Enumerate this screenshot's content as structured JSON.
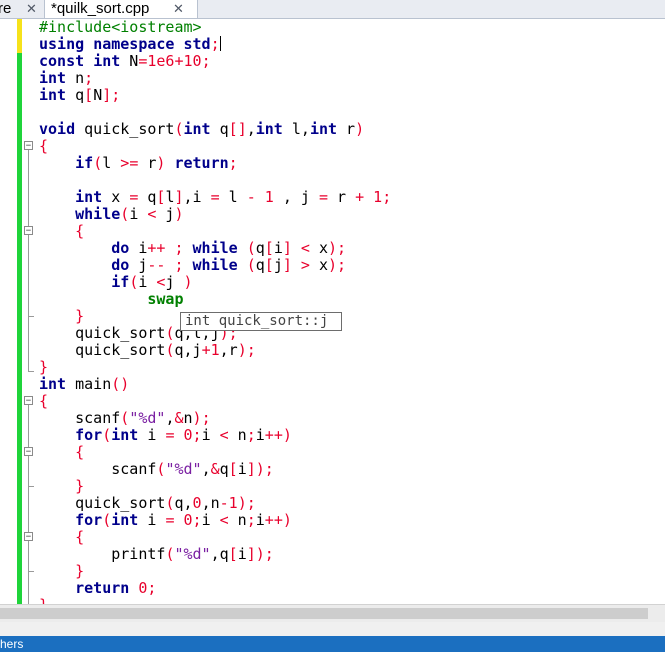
{
  "tabs": [
    {
      "label": "re",
      "close": "✕",
      "active": false
    },
    {
      "label": "*quilk_sort.cpp",
      "close": "✕",
      "active": true
    }
  ],
  "code_lines": [
    "#include<iostream>",
    "using namespace std;",
    "const int N=1e6+10;",
    "int n;",
    "int q[N];",
    "",
    "void quick_sort(int q[],int l,int r)",
    "{",
    "    if(l >= r) return;",
    "",
    "    int x = q[l],i = l - 1 , j = r + 1;",
    "    while(i < j)",
    "    {",
    "        do i++ ; while (q[i] < x);",
    "        do j-- ; while (q[j] > x);",
    "        if(i <j )",
    "            swap",
    "    }",
    "    quick_sort(q,l,j);",
    "    quick_sort(q,j+1,r);",
    "}",
    "int main()",
    "{",
    "    scanf(\"%d\",&n);",
    "    for(int i = 0;i < n;i++)",
    "    {",
    "        scanf(\"%d\",&q[i]);",
    "    }",
    "    quick_sort(q,0,n-1);",
    "    for(int i = 0;i < n;i++)",
    "    {",
    "        printf(\"%d\",q[i]);",
    "    }",
    "    return 0;",
    "}"
  ],
  "tooltip": "int quick_sort::j",
  "status_text": "hers",
  "colors": {
    "keyword": "#00008b",
    "preprocessor": "#008000",
    "number": "#e8002c",
    "change_bar": "#1fd43a",
    "status_bar": "#1b6fc0"
  }
}
